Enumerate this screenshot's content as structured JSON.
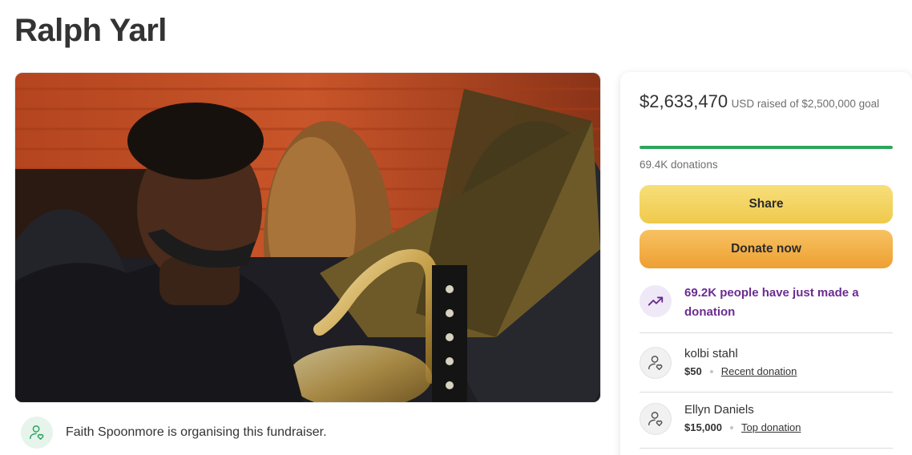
{
  "page": {
    "title": "Ralph Yarl"
  },
  "organiser": {
    "text": "Faith Spoonmore is organising this fundraiser.",
    "icon": "user-heart-icon"
  },
  "summary": {
    "amount": "$2,633,470",
    "raised_text": "USD raised of $2,500,000 goal",
    "progress_fraction": 1.0,
    "donations": "69.4K donations"
  },
  "actions": {
    "share_label": "Share",
    "donate_label": "Donate now"
  },
  "trend": {
    "text": "69.2K people have just made a donation",
    "icon": "trending-up-icon"
  },
  "donors": [
    {
      "name": "kolbi stahl",
      "amount": "$50",
      "tag": "Recent donation"
    },
    {
      "name": "Ellyn Daniels",
      "amount": "$15,000",
      "tag": "Top donation"
    }
  ],
  "colors": {
    "progress": "#2ea55c",
    "share_button": "#f2d35c",
    "donate_button": "#f1ad43",
    "trend_text": "#6b2c91"
  }
}
